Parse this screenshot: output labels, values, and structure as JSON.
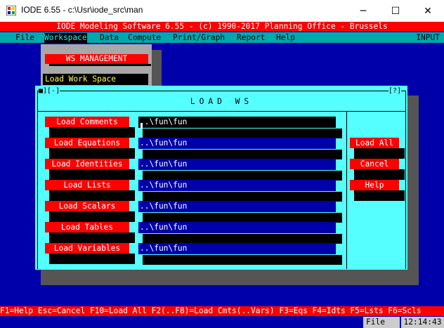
{
  "window": {
    "title": "IODE 6.55 - c:\\Usr\\iode_src\\man",
    "app_icon": "iode-app-icon",
    "minimize": "─",
    "maximize": "☐",
    "close": "✕"
  },
  "header": {
    "text": "IODE Modeling Software 6.55 - (c) 1990-2017 Planning Office - Brussels"
  },
  "menubar": {
    "items": [
      "File",
      "Workspace",
      "Data",
      "Compute",
      "Print/Graph",
      "Report",
      "Help"
    ],
    "active": "Workspace",
    "mode": "INPUT"
  },
  "ws_management": {
    "title": "WS MANAGEMENT",
    "selected_item": "Load Work Space"
  },
  "dialog": {
    "control": "■][-]",
    "help": "[?]",
    "title": "LOAD WS",
    "rows": [
      {
        "label": "Load Comments",
        "value": "..\\fun\\fun"
      },
      {
        "label": "Load Equations",
        "value": "..\\fun\\fun"
      },
      {
        "label": "Load Identities",
        "value": "..\\fun\\fun"
      },
      {
        "label": "Load Lists",
        "value": "..\\fun\\fun"
      },
      {
        "label": "Load Scalars",
        "value": "..\\fun\\fun"
      },
      {
        "label": "Load Tables",
        "value": "..\\fun\\fun"
      },
      {
        "label": "Load Variables",
        "value": "..\\fun\\fun"
      }
    ],
    "buttons": {
      "load_all": "Load All",
      "cancel": "Cancel",
      "help": "Help"
    }
  },
  "function_keys": "F1=Help Esc=Cancel F10=Load All F2(..F8)=Load Cmts(..Vars) F3=Eqs F4=Idts F5=Lsts F6=Scls",
  "status": {
    "mode": "File",
    "time": "12:14:43"
  },
  "colors": {
    "console_bg": "#0000ab",
    "dialog_bg": "#55ffff",
    "button_red": "#ff0000",
    "field_blue": "#0000aa",
    "menubar_bg": "#00aaaa"
  }
}
